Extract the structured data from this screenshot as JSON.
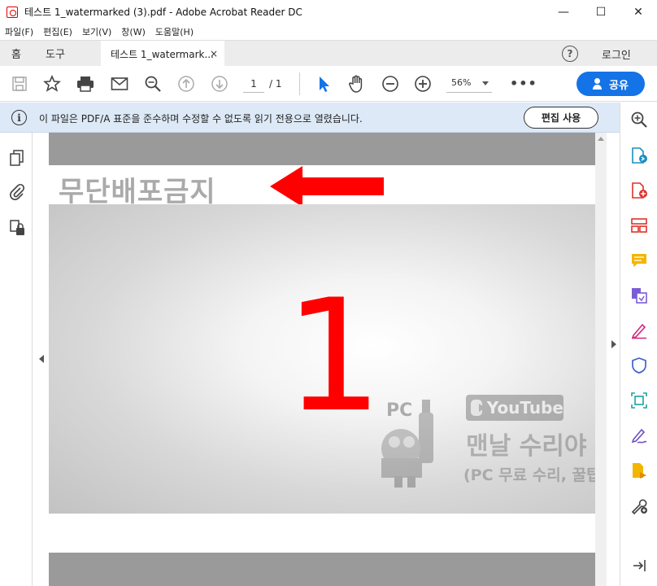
{
  "window": {
    "title": "테스트 1_watermarked (3).pdf - Adobe Acrobat Reader DC",
    "minimize": "—",
    "maximize": "☐",
    "close": "✕"
  },
  "menubar": {
    "items": [
      "파일(F)",
      "편집(E)",
      "보기(V)",
      "창(W)",
      "도움말(H)"
    ]
  },
  "tabs": {
    "home": "홈",
    "tools": "도구",
    "document": "테스트 1_watermark...",
    "close": "×",
    "help": "?",
    "login": "로그인"
  },
  "toolbar": {
    "page_current": "1",
    "page_total": "/ 1",
    "zoom": "56%",
    "more": "•••",
    "share_label": "공유"
  },
  "infobar": {
    "icon": "i",
    "message": "이 파일은 PDF/A 표준을 준수하며 수정할 수 없도록 읽기 전용으로 열렸습니다.",
    "button_label": "편집 사용"
  },
  "document": {
    "watermark_text": "무단배포금지",
    "big_number": "1",
    "wm_logo_text": "PC",
    "yt_text": "YouTube",
    "channel_name": "맨날 수리야",
    "channel_sub": "(PC 무료 수리, 꿀팁)"
  },
  "colors": {
    "accent": "#1473e6",
    "red": "#ff0000",
    "infobar_bg": "#dde9f6"
  },
  "icons": {
    "left": [
      "pages-icon",
      "attachment-icon",
      "security-icon"
    ],
    "right": [
      "zoom-in-icon",
      "export-pdf-icon",
      "create-pdf-icon",
      "organize-pages-icon",
      "comment-icon",
      "combine-icon",
      "fill-sign-icon",
      "protect-icon",
      "scan-icon",
      "request-signature-icon",
      "send-for-review-icon",
      "more-tools-icon",
      "expand-panel-icon"
    ]
  }
}
